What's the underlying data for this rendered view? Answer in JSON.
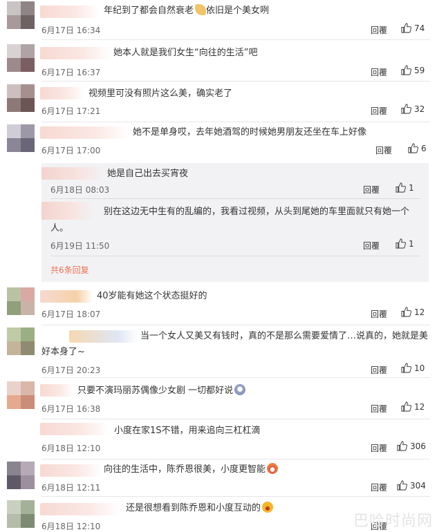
{
  "reply_label": "回覆",
  "comments": [
    {
      "text": "年纪到了都会自然衰老",
      "text_tail": "依旧是个美女咧",
      "time": "6月17日 16:34",
      "likes": "74"
    },
    {
      "text": "她本人就是我们女生“向往的生活”吧",
      "time": "6月17日 16:37",
      "likes": "59"
    },
    {
      "text": "视频里可没有照片这么美，确实老了",
      "time": "6月17日 17:21",
      "likes": "32"
    },
    {
      "text": "她不是单身哎，去年她酒驾的时候她男朋友还坐在车上好像",
      "time": "6月17日 17:00",
      "likes": "6"
    },
    {
      "text": "40岁能有她这个状态挺好的",
      "time": "6月17日 18:07",
      "likes": "12"
    },
    {
      "text": "当一个女人又美又有钱时，真的不是那么需要爱情了…说真的，她就是美",
      "text_line2": "好本身了~",
      "time": "6月17日 20:23",
      "likes": "10"
    },
    {
      "text": "只要不演玛丽苏偶像少女剧 一切都好说",
      "time": "6月17日 16:38",
      "likes": "12"
    },
    {
      "text": "小度在家1S不错，用来追向三杠杠滴",
      "time": "6月18日 12:10",
      "likes": "306"
    },
    {
      "text": "向往的生活中，陈乔恩很美，小度更智能",
      "time": "6月18日 12:11",
      "likes": "304"
    },
    {
      "text": "还是很想看到陈乔恩和小度互动的",
      "time": "6月18日 12:10",
      "likes": ""
    }
  ],
  "replies": [
    {
      "text": "她是自己出去买宵夜",
      "time": "6月18日 08:03",
      "likes": "1"
    },
    {
      "text": "别在这边无中生有的乱编的，我看过视频，从头到尾她的车里面就只有她一个",
      "text_line2": "人。",
      "time": "6月19日 11:50",
      "likes": "1"
    }
  ],
  "more_replies": "共6条回复",
  "watermark": "巴哈时尚网",
  "colors": {
    "accent": "#eb7350",
    "reply_bg": "#f2f2f5"
  }
}
